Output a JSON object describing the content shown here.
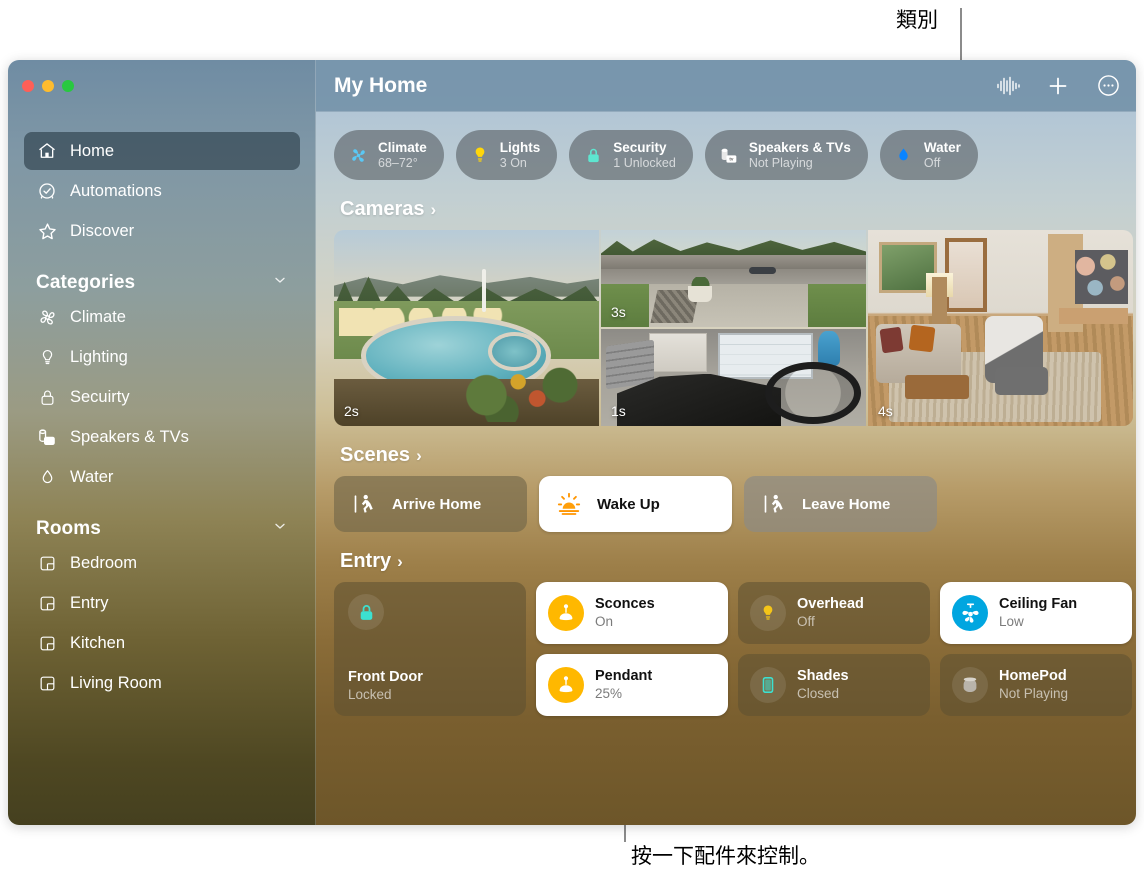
{
  "callouts": {
    "top": "類別",
    "bottom": "按一下配件來控制。"
  },
  "window": {
    "title": "My Home",
    "titlebar_actions": [
      {
        "name": "siri-waveform-icon",
        "label": "Siri"
      },
      {
        "name": "add-icon",
        "label": "Add"
      },
      {
        "name": "more-icon",
        "label": "More"
      }
    ],
    "traffic_lights": [
      {
        "name": "close",
        "color": "#ff5f57"
      },
      {
        "name": "minimize",
        "color": "#febc2e"
      },
      {
        "name": "zoom",
        "color": "#28c840"
      }
    ]
  },
  "sidebar": {
    "top_items": [
      {
        "label": "Home",
        "icon": "house-icon",
        "active": true
      },
      {
        "label": "Automations",
        "icon": "clock-check-icon",
        "active": false
      },
      {
        "label": "Discover",
        "icon": "star-icon",
        "active": false
      }
    ],
    "categories_header": "Categories",
    "categories": [
      {
        "label": "Climate",
        "icon": "fan-icon"
      },
      {
        "label": "Lighting",
        "icon": "bulb-icon"
      },
      {
        "label": "Secuirty",
        "icon": "lock-icon"
      },
      {
        "label": "Speakers & TVs",
        "icon": "speaker-tv-icon"
      },
      {
        "label": "Water",
        "icon": "droplet-icon"
      }
    ],
    "rooms_header": "Rooms",
    "rooms": [
      {
        "label": "Bedroom",
        "icon": "room-icon"
      },
      {
        "label": "Entry",
        "icon": "room-icon"
      },
      {
        "label": "Kitchen",
        "icon": "room-icon"
      },
      {
        "label": "Living Room",
        "icon": "room-icon"
      }
    ]
  },
  "pills": [
    {
      "name": "Climate",
      "value": "68–72°",
      "icon": "fan-icon",
      "color": "#5ac8f5"
    },
    {
      "name": "Lights",
      "value": "3 On",
      "icon": "bulb-icon",
      "color": "#ffd60a"
    },
    {
      "name": "Security",
      "value": "1 Unlocked",
      "icon": "lock-icon",
      "color": "#5ee6d0"
    },
    {
      "name": "Speakers & TVs",
      "value": "Not Playing",
      "icon": "speaker-tv-icon",
      "color": "#ffffff"
    },
    {
      "name": "Water",
      "value": "Off",
      "icon": "droplet-icon",
      "color": "#0a84ff"
    }
  ],
  "sections": {
    "cameras": {
      "title": "Cameras",
      "chevron": "›"
    },
    "scenes": {
      "title": "Scenes",
      "chevron": "›"
    },
    "entry": {
      "title": "Entry",
      "chevron": "›"
    }
  },
  "cameras": [
    {
      "name": "pool-camera",
      "timestamp": "2s"
    },
    {
      "name": "driveway-camera",
      "timestamp": "3s"
    },
    {
      "name": "garage-camera",
      "timestamp": "1s"
    },
    {
      "name": "living-room-camera",
      "timestamp": "4s"
    }
  ],
  "scenes": [
    {
      "label": "Arrive Home",
      "icon": "walk-in-icon",
      "state": "dim"
    },
    {
      "label": "Wake Up",
      "icon": "sunrise-icon",
      "state": "lit"
    },
    {
      "label": "Leave Home",
      "icon": "walk-out-icon",
      "state": "dim2"
    }
  ],
  "accessories": [
    {
      "name": "Front Door",
      "value": "Locked",
      "icon": "lock-icon",
      "state": "dim",
      "tall": true,
      "icon_color": "#3ce0d0"
    },
    {
      "name": "Sconces",
      "value": "On",
      "icon": "sconce-icon",
      "state": "lit",
      "tall": false,
      "icon_color": "#ffb800"
    },
    {
      "name": "Overhead",
      "value": "Off",
      "icon": "bulb-icon",
      "state": "dim",
      "tall": false,
      "icon_color": "#f5c518"
    },
    {
      "name": "Ceiling Fan",
      "value": "Low",
      "icon": "fan-icon",
      "state": "lit",
      "tall": false,
      "icon_color": "#00a6e0"
    },
    {
      "name": "Pendant",
      "value": "25%",
      "icon": "pendant-icon",
      "state": "lit",
      "tall": false,
      "icon_color": "#ffb800"
    },
    {
      "name": "Shades",
      "value": "Closed",
      "icon": "shade-icon",
      "state": "dim",
      "tall": false,
      "icon_color": "#3ce0d0"
    },
    {
      "name": "HomePod",
      "value": "Not Playing",
      "icon": "homepod-icon",
      "state": "dim",
      "tall": false,
      "icon_color": "#c9c4bb"
    }
  ]
}
